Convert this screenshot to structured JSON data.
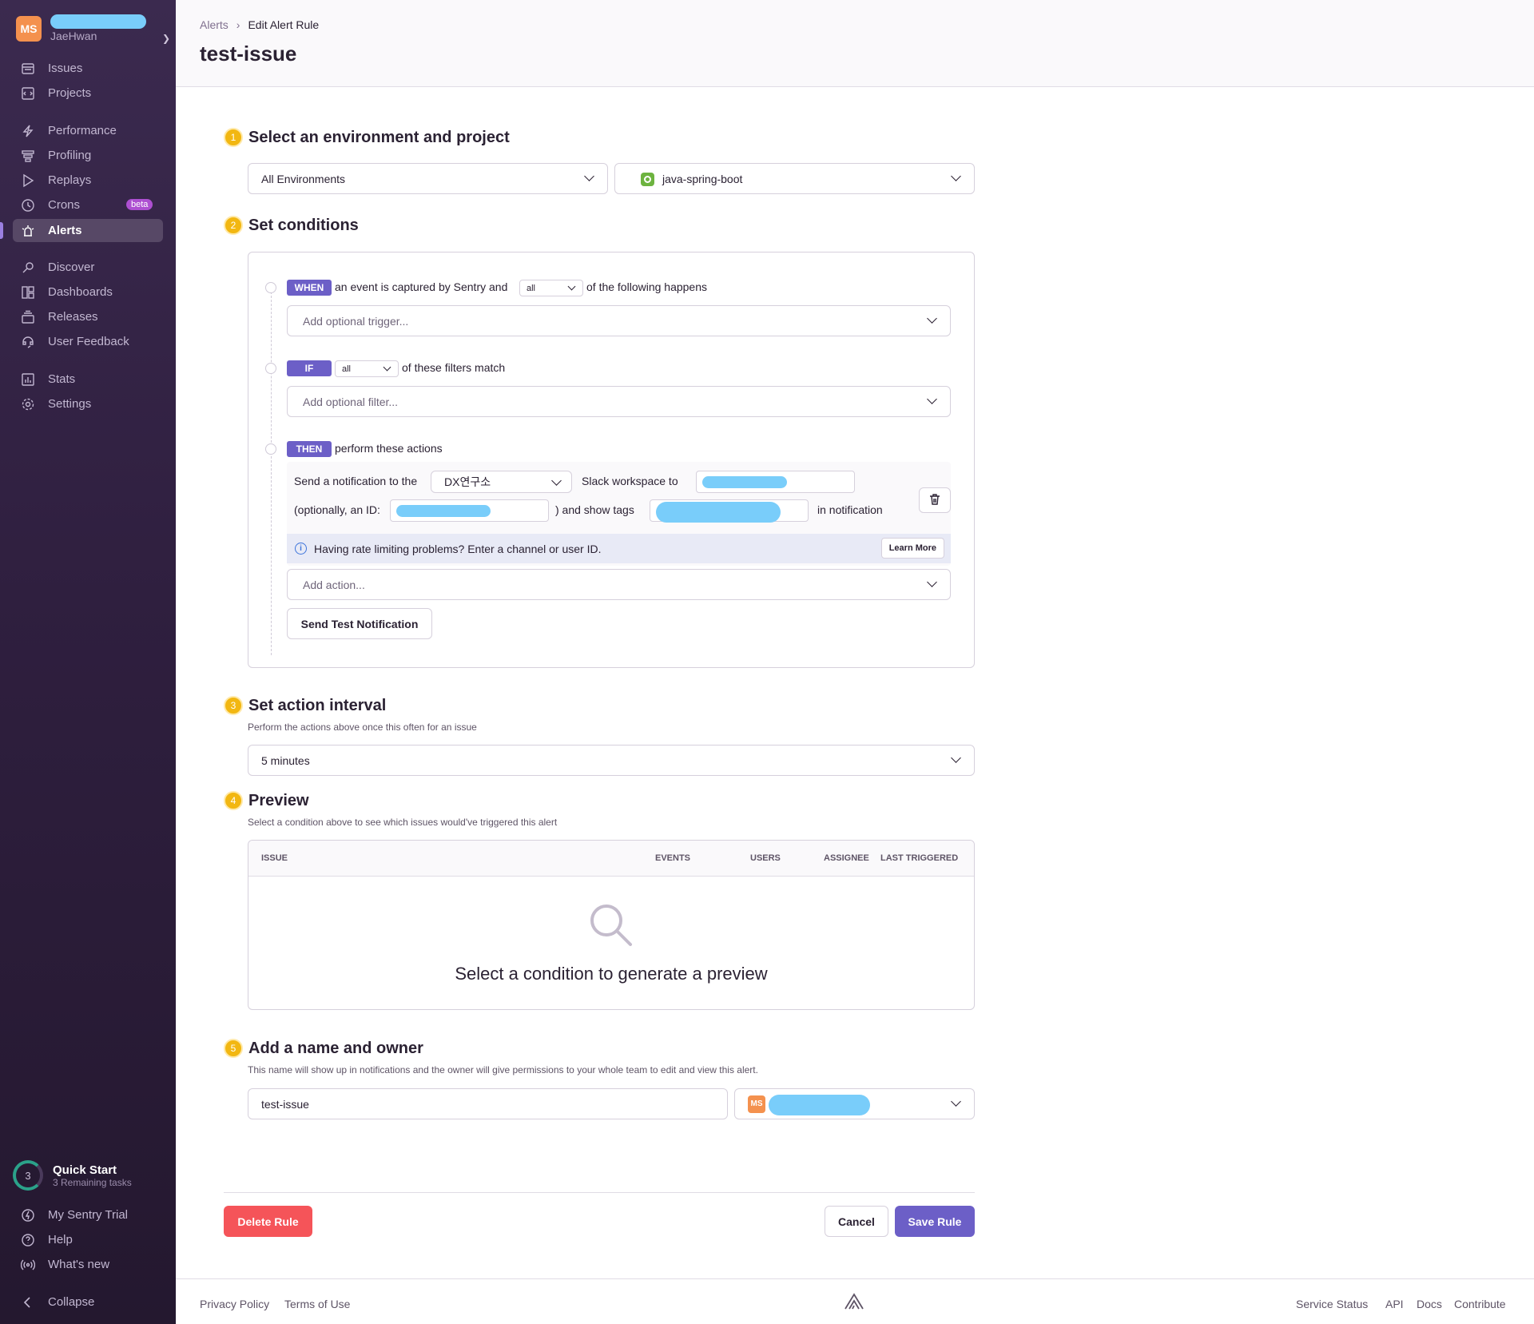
{
  "sidebar": {
    "org_avatar": "MS",
    "org_user": "JaeHwan",
    "items": [
      {
        "label": "Issues",
        "icon": "issues-icon"
      },
      {
        "label": "Projects",
        "icon": "projects-icon"
      },
      {
        "label": "Performance",
        "icon": "performance-icon"
      },
      {
        "label": "Profiling",
        "icon": "profiling-icon"
      },
      {
        "label": "Replays",
        "icon": "replays-icon"
      },
      {
        "label": "Crons",
        "icon": "crons-icon",
        "badge": "beta"
      },
      {
        "label": "Alerts",
        "icon": "alerts-icon",
        "active": true
      },
      {
        "label": "Discover",
        "icon": "discover-icon"
      },
      {
        "label": "Dashboards",
        "icon": "dashboards-icon"
      },
      {
        "label": "Releases",
        "icon": "releases-icon"
      },
      {
        "label": "User Feedback",
        "icon": "user-feedback-icon"
      },
      {
        "label": "Stats",
        "icon": "stats-icon"
      },
      {
        "label": "Settings",
        "icon": "settings-icon"
      }
    ],
    "quick_start": {
      "count": "3",
      "title": "Quick Start",
      "subtitle": "3 Remaining tasks"
    },
    "bottom": [
      {
        "label": "My Sentry Trial",
        "icon": "trial-icon"
      },
      {
        "label": "Help",
        "icon": "help-icon"
      },
      {
        "label": "What's new",
        "icon": "broadcast-icon"
      },
      {
        "label": "Collapse",
        "icon": "collapse-icon"
      }
    ]
  },
  "header": {
    "breadcrumb": [
      "Alerts",
      "Edit Alert Rule"
    ],
    "title": "test-issue"
  },
  "steps": {
    "s1": {
      "num": "1",
      "title": "Select an environment and project",
      "environment": "All Environments",
      "project": "java-spring-boot"
    },
    "s2": {
      "num": "2",
      "title": "Set conditions",
      "when": {
        "badge": "WHEN",
        "text_before": "an event is captured by Sentry and",
        "match": "all",
        "text_after": "of the following happens",
        "placeholder": "Add optional trigger..."
      },
      "if": {
        "badge": "IF",
        "match": "all",
        "text_after": "of these filters match",
        "placeholder": "Add optional filter..."
      },
      "then": {
        "badge": "THEN",
        "text_after": "perform these actions",
        "send_label": "Send a notification to the",
        "workspace": "DX연구소",
        "workspace_label": "Slack workspace to",
        "id_label": "(optionally, an ID:",
        "tags_label": ") and show tags",
        "in_label": "in notification",
        "info": "Having rate limiting problems? Enter a channel or user ID.",
        "learn_more": "Learn More",
        "add_action": "Add action...",
        "test_button": "Send Test Notification"
      }
    },
    "s3": {
      "num": "3",
      "title": "Set action interval",
      "desc": "Perform the actions above once this often for an issue",
      "interval": "5 minutes"
    },
    "s4": {
      "num": "4",
      "title": "Preview",
      "desc": "Select a condition above to see which issues would've triggered this alert",
      "columns": [
        "ISSUE",
        "EVENTS",
        "USERS",
        "ASSIGNEE",
        "LAST TRIGGERED"
      ],
      "empty": "Select a condition to generate a preview"
    },
    "s5": {
      "num": "5",
      "title": "Add a name and owner",
      "desc": "This name will show up in notifications and the owner will give permissions to your whole team to edit and view this alert.",
      "name_value": "test-issue",
      "owner_avatar": "MS"
    }
  },
  "actions": {
    "delete": "Delete Rule",
    "cancel": "Cancel",
    "save": "Save Rule"
  },
  "footer": {
    "privacy": "Privacy Policy",
    "terms": "Terms of Use",
    "status": "Service Status",
    "api": "API",
    "docs": "Docs",
    "contribute": "Contribute"
  },
  "colors": {
    "accent": "#6c5fc7",
    "danger": "#f55459",
    "step": "#f2b712",
    "sidebar": "#2f1f3f"
  }
}
